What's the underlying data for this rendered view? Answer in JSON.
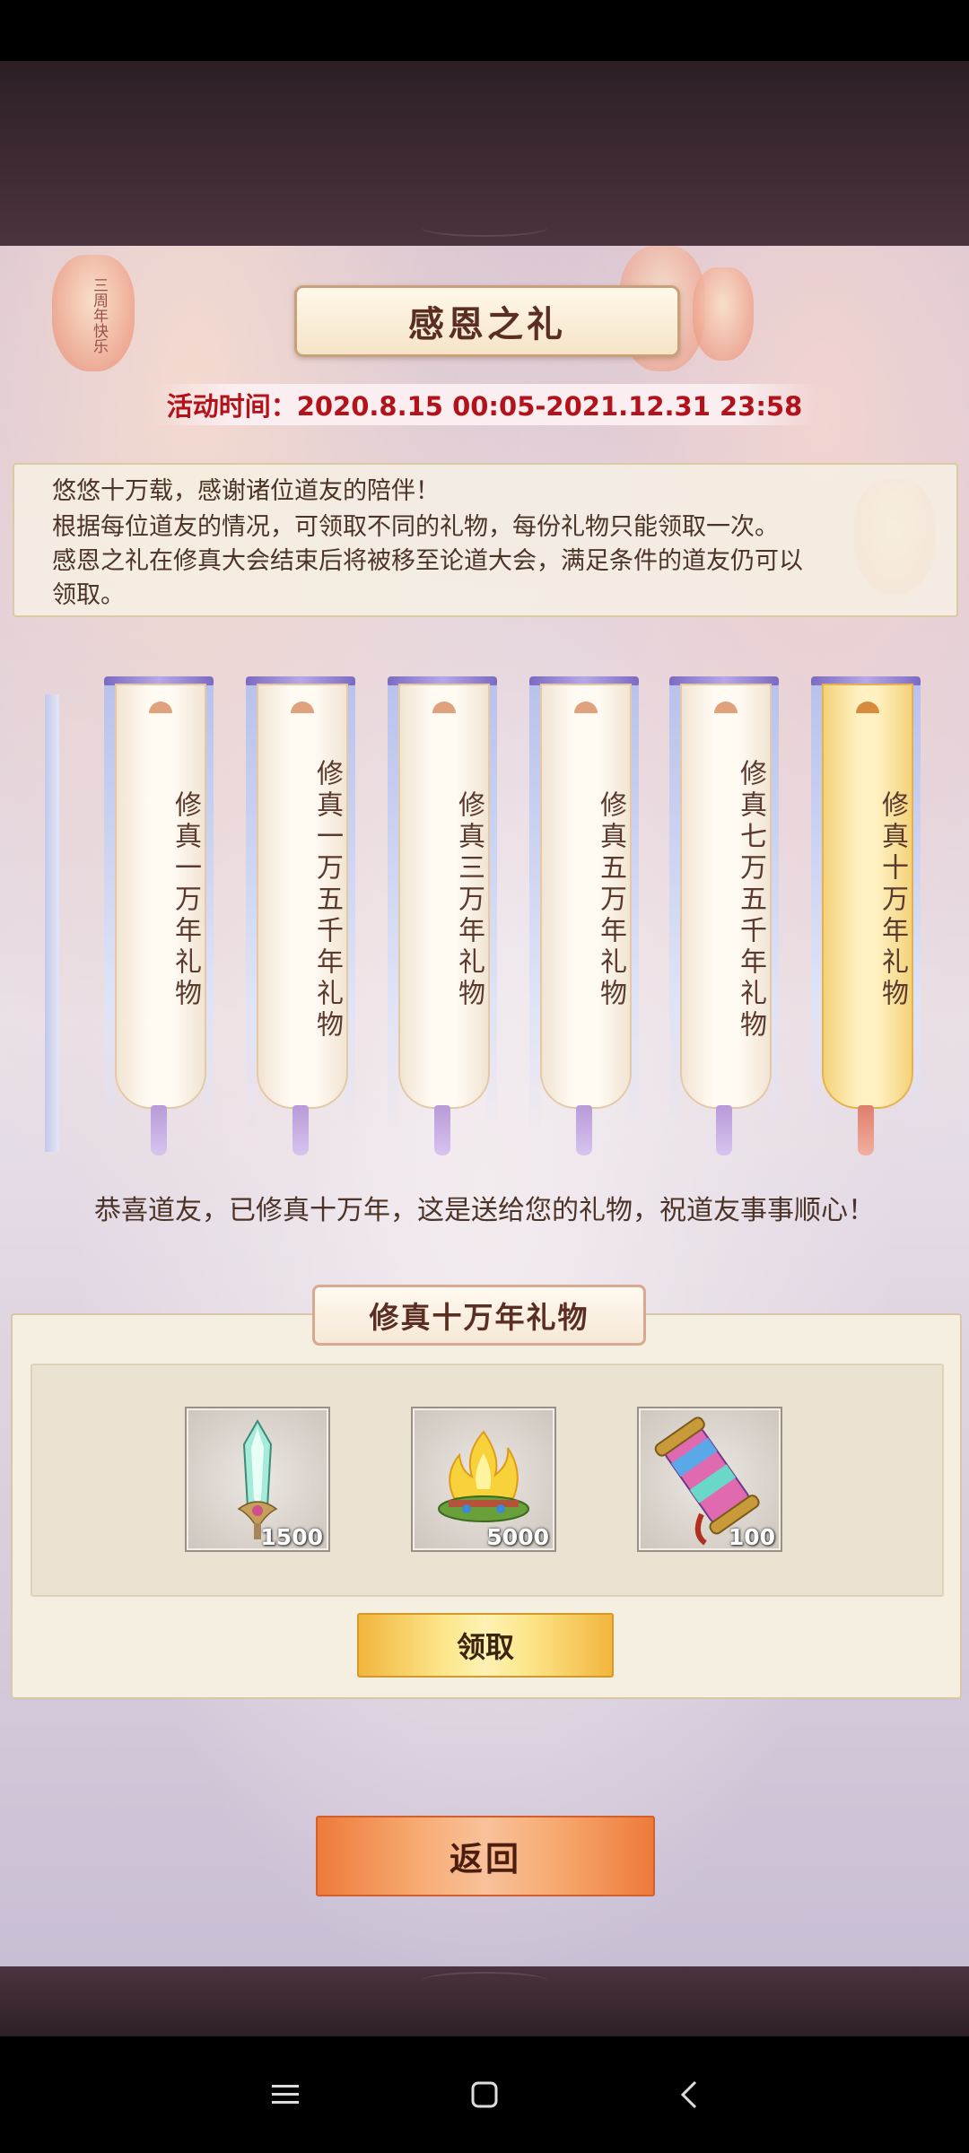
{
  "colors": {
    "time_text": "#b3121a",
    "claim_button": "#fde88e",
    "back_button": "#f7ab72",
    "active_banner": "#fff1c2"
  },
  "decor": {
    "lantern_text": "三周年快乐"
  },
  "header": {
    "title": "感恩之礼",
    "event_time": "活动时间：2020.8.15 00:05-2021.12.31 23:58"
  },
  "description": {
    "lines": [
      "悠悠十万载，感谢诸位道友的陪伴！",
      "根据每位道友的情况，可领取不同的礼物，每份礼物只能领取一次。",
      "感恩之礼在修真大会结束后将被移至论道大会，满足条件的道友仍可以",
      "领取。"
    ]
  },
  "tiers": [
    {
      "label": "修真一万年礼物",
      "active": false
    },
    {
      "label": "修真一万五千年礼物",
      "active": false
    },
    {
      "label": "修真三万年礼物",
      "active": false
    },
    {
      "label": "修真五万年礼物",
      "active": false
    },
    {
      "label": "修真七万五千年礼物",
      "active": false
    },
    {
      "label": "修真十万年礼物",
      "active": true
    }
  ],
  "congrats": "恭喜道友，已修真十万年，这是送给您的礼物，祝道友事事顺心！",
  "reward": {
    "title": "修真十万年礼物",
    "items": [
      {
        "icon": "sword-icon",
        "qty": "1500"
      },
      {
        "icon": "flame-icon",
        "qty": "5000"
      },
      {
        "icon": "scroll-icon",
        "qty": "100"
      }
    ],
    "claim_label": "领取"
  },
  "back_label": "返回",
  "nav": {
    "menu": "menu-icon",
    "home": "home-icon",
    "back": "back-icon"
  }
}
